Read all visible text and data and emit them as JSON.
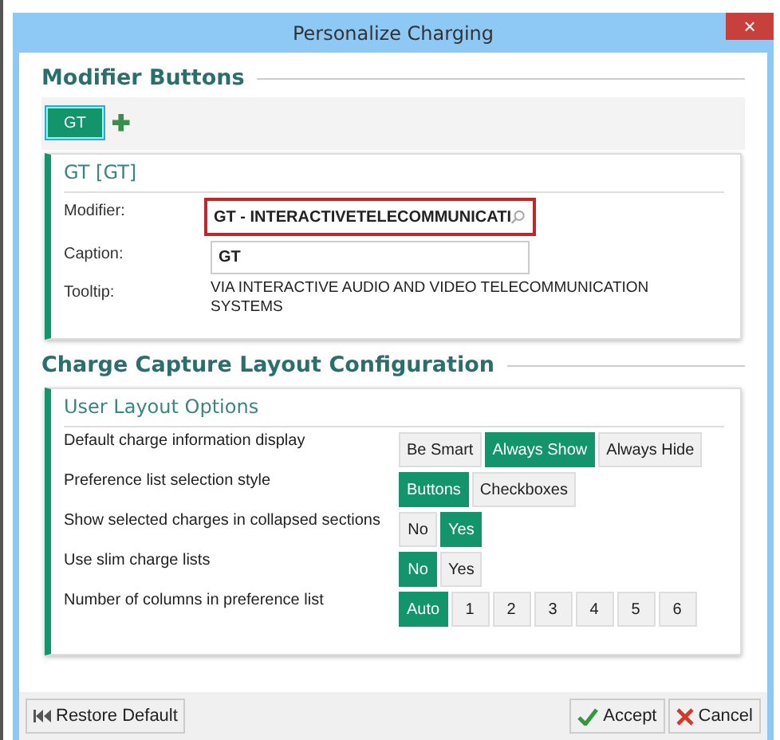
{
  "window": {
    "title": "Personalize Charging",
    "close": "×"
  },
  "modifier_section": {
    "heading": "Modifier Buttons",
    "buttons": [
      {
        "label": "GT",
        "selected": true
      }
    ],
    "add": "✚",
    "card": {
      "title": "GT [GT]",
      "fields": [
        {
          "kind": "search",
          "label": "Modifier:",
          "value": "GT - INTERACTIVETELECOMMUNICATI",
          "highlighted": true
        },
        {
          "kind": "input",
          "label": "Caption:",
          "value": "GT",
          "highlighted": false
        },
        {
          "kind": "text",
          "label": "Tooltip:",
          "value": "VIA INTERACTIVE AUDIO AND VIDEO TELECOMMUNICATION SYSTEMS"
        }
      ]
    }
  },
  "layout_section": {
    "heading": "Charge Capture Layout Configuration",
    "card": {
      "title": "User Layout Options",
      "options": [
        {
          "label": "Default charge information display",
          "choices": [
            {
              "label": "Be Smart",
              "selected": false
            },
            {
              "label": "Always Show",
              "selected": true
            },
            {
              "label": "Always Hide",
              "selected": false
            }
          ]
        },
        {
          "label": "Preference list selection style",
          "choices": [
            {
              "label": "Buttons",
              "selected": true
            },
            {
              "label": "Checkboxes",
              "selected": false
            }
          ]
        },
        {
          "label": "Show selected charges in collapsed sections",
          "choices": [
            {
              "label": "No",
              "selected": false
            },
            {
              "label": "Yes",
              "selected": true
            }
          ]
        },
        {
          "label": "Use slim charge lists",
          "choices": [
            {
              "label": "No",
              "selected": true
            },
            {
              "label": "Yes",
              "selected": false
            }
          ]
        },
        {
          "label": "Number of columns in preference list",
          "choices": [
            {
              "label": "Auto",
              "selected": true
            },
            {
              "label": "1",
              "selected": false
            },
            {
              "label": "2",
              "selected": false
            },
            {
              "label": "3",
              "selected": false
            },
            {
              "label": "4",
              "selected": false
            },
            {
              "label": "5",
              "selected": false
            },
            {
              "label": "6",
              "selected": false
            }
          ]
        }
      ]
    }
  },
  "footer": {
    "restore": "Restore Default",
    "accept": "Accept",
    "cancel": "Cancel"
  }
}
